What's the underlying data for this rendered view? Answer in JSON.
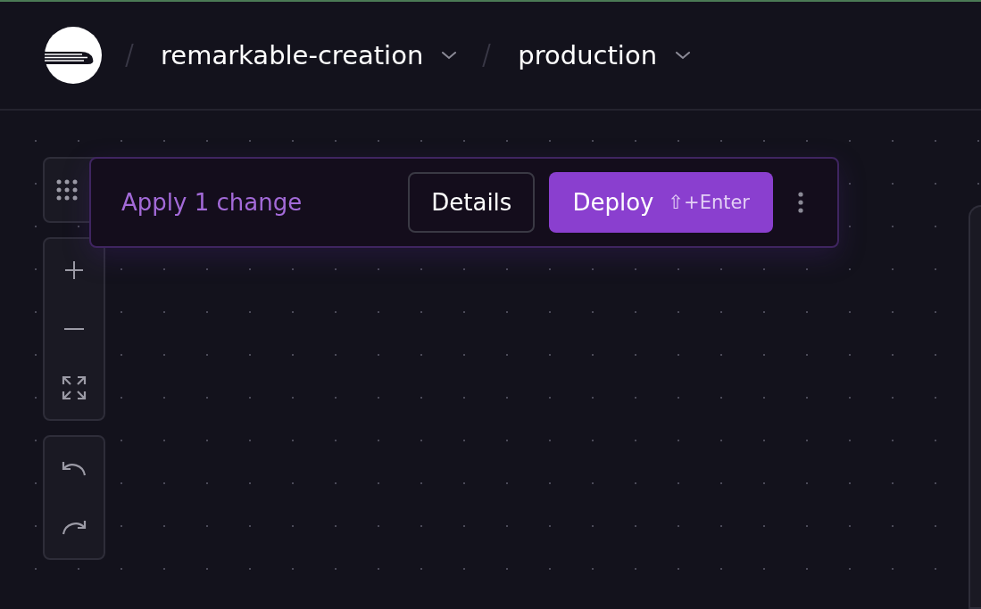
{
  "breadcrumbs": [
    {
      "label": "remarkable-creation"
    },
    {
      "label": "production"
    }
  ],
  "change_bar": {
    "message": "Apply 1 change",
    "details_button": "Details",
    "deploy_button": "Deploy",
    "shortcut": "⇧+Enter"
  }
}
